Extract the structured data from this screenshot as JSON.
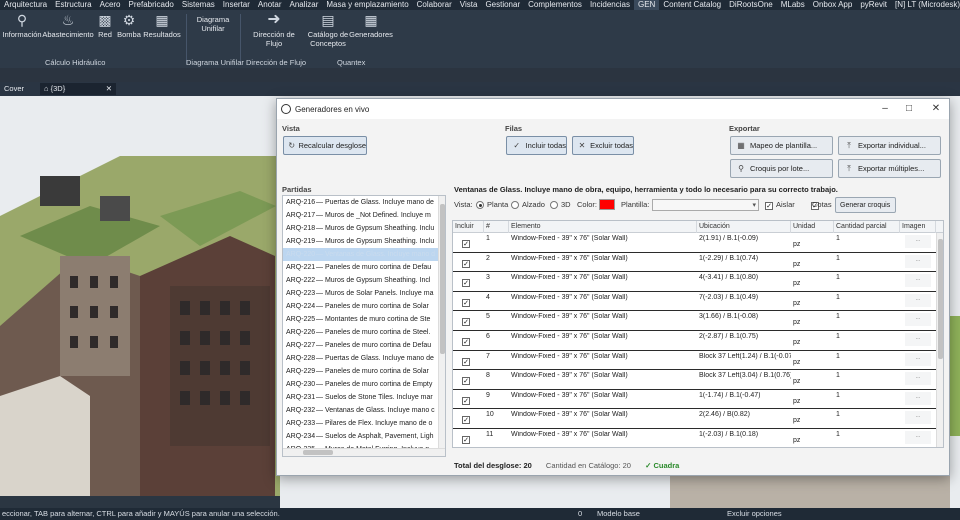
{
  "menu": {
    "tabs": [
      "Arquitectura",
      "Estructura",
      "Acero",
      "Prefabricado",
      "Sistemas",
      "Insertar",
      "Anotar",
      "Analizar",
      "Masa y emplazamiento",
      "Colaborar",
      "Vista",
      "Gestionar",
      "Complementos",
      "Incidencias",
      "GEN",
      "Content Catalog",
      "DiRootsOne",
      "MLabs",
      "Onbox App",
      "pyRevit",
      "[N] LT (Microdesk)"
    ],
    "active": "GEN"
  },
  "ribbon": {
    "buttons": {
      "informacion": "Información",
      "abastecimiento": "Abastecimiento",
      "red": "Red",
      "bomba": "Bomba",
      "resultados": "Resultados",
      "diagrama_unifilar_1": "Diagrama",
      "diagrama_unifilar_2": "Unifilar",
      "direccion_flujo": "Dirección de Flujo",
      "catalogo_1": "Catálogo de",
      "catalogo_2": "Conceptos",
      "generadores": "Generadores"
    },
    "groups": {
      "calculo": "Cálculo Hidráulico",
      "diagrama": "Diagrama Unifilar",
      "flujo": "Dirección de Flujo",
      "quantex": "Quantex"
    }
  },
  "doc_tabs": {
    "cover": "Cover",
    "view3d": "{3D}"
  },
  "dialog": {
    "title": "Generadores en vivo",
    "vista": {
      "label": "Vista",
      "recalcular": "Recalcular desglose"
    },
    "filas": {
      "label": "Filas",
      "incluir": "Incluir todas",
      "excluir": "Excluir todas"
    },
    "exportar": {
      "label": "Exportar",
      "mapeo": "Mapeo de plantilla...",
      "croquis": "Croquis por lote...",
      "individual": "Exportar individual...",
      "multiples": "Exportar múltiples..."
    },
    "partidas": {
      "label": "Partidas",
      "items": [
        {
          "code": "ARQ-216",
          "text": "— Puertas de Glass. Incluye mano de"
        },
        {
          "code": "ARQ-217",
          "text": "— Muros de _Not Defined. Incluye m"
        },
        {
          "code": "ARQ-218",
          "text": "— Muros de Gypsum Sheathing. Inclu"
        },
        {
          "code": "ARQ-219",
          "text": "— Muros de Gypsum Sheathing. Inclu"
        },
        {
          "code": "ARQ-220",
          "text": "— Ventanas de Glass. Incluye mano d"
        },
        {
          "code": "ARQ-221",
          "text": "— Paneles de muro cortina de Defau"
        },
        {
          "code": "ARQ-222",
          "text": "— Muros de Gypsum Sheathing. Incl"
        },
        {
          "code": "ARQ-223",
          "text": "— Muros de Solar Panels. Incluye ma"
        },
        {
          "code": "ARQ-224",
          "text": "— Paneles de muro cortina de Solar"
        },
        {
          "code": "ARQ-225",
          "text": "— Montantes de muro cortina de Ste"
        },
        {
          "code": "ARQ-226",
          "text": "— Paneles de muro cortina de Steel."
        },
        {
          "code": "ARQ-227",
          "text": "— Paneles de muro cortina de Defau"
        },
        {
          "code": "ARQ-228",
          "text": "— Puertas de Glass. Incluye mano de"
        },
        {
          "code": "ARQ-229",
          "text": "— Paneles de muro cortina de Solar"
        },
        {
          "code": "ARQ-230",
          "text": "— Paneles de muro cortina de Empty"
        },
        {
          "code": "ARQ-231",
          "text": "— Suelos de Stone Tiles. Incluye mar"
        },
        {
          "code": "ARQ-232",
          "text": "— Ventanas de Glass. Incluye mano c"
        },
        {
          "code": "ARQ-233",
          "text": "— Pilares de Flex. Incluye mano de o"
        },
        {
          "code": "ARQ-234",
          "text": "— Suelos de Asphalt, Pavement, Ligh"
        },
        {
          "code": "ARQ-235",
          "text": "— Muros de Metal Furring. Incluye n"
        }
      ]
    },
    "description": "Ventanas de Glass. Incluye mano de obra, equipo, herramienta y todo lo necesario para su correcto trabajo.",
    "options": {
      "vista_label": "Vista:",
      "planta": "Planta",
      "alzado": "Alzado",
      "tres_d": "3D",
      "color_label": "Color:",
      "color": "#ff0000",
      "plantilla_label": "Plantilla:",
      "aislar": "Aislar",
      "cotas": "Cotas",
      "generar": "Generar croquis"
    },
    "grid": {
      "headers": [
        "Incluir",
        "#",
        "Elemento",
        "Ubicación",
        "Unidad",
        "Cantidad parcial",
        "Imagen"
      ],
      "rows": [
        {
          "n": "1",
          "elemento": "Window-Fixed - 39\" x 76\" (Solar Wall)",
          "ubicacion": "2(1.91) / B.1(-0.09)",
          "unidad": "pz",
          "cantidad": "1"
        },
        {
          "n": "2",
          "elemento": "Window-Fixed - 39\" x 76\" (Solar Wall)",
          "ubicacion": "1(-2.29) / B.1(0.74)",
          "unidad": "pz",
          "cantidad": "1"
        },
        {
          "n": "3",
          "elemento": "Window-Fixed - 39\" x 76\" (Solar Wall)",
          "ubicacion": "4(-3.41) / B.1(0.80)",
          "unidad": "pz",
          "cantidad": "1"
        },
        {
          "n": "4",
          "elemento": "Window-Fixed - 39\" x 76\" (Solar Wall)",
          "ubicacion": "7(-2.03) / B.1(0.49)",
          "unidad": "pz",
          "cantidad": "1"
        },
        {
          "n": "5",
          "elemento": "Window-Fixed - 39\" x 76\" (Solar Wall)",
          "ubicacion": "3(1.66) / B.1(-0.08)",
          "unidad": "pz",
          "cantidad": "1"
        },
        {
          "n": "6",
          "elemento": "Window-Fixed - 39\" x 76\" (Solar Wall)",
          "ubicacion": "2(-2.87) / B.1(0.75)",
          "unidad": "pz",
          "cantidad": "1"
        },
        {
          "n": "7",
          "elemento": "Window-Fixed - 39\" x 76\" (Solar Wall)",
          "ubicacion": "Block 37 Left(1.24) / B.1(-0.07",
          "unidad": "pz",
          "cantidad": "1"
        },
        {
          "n": "8",
          "elemento": "Window-Fixed - 39\" x 76\" (Solar Wall)",
          "ubicacion": "Block 37 Left(3.04) / B.1(0.76)",
          "unidad": "pz",
          "cantidad": "1"
        },
        {
          "n": "9",
          "elemento": "Window-Fixed - 39\" x 76\" (Solar Wall)",
          "ubicacion": "1(-1.74) / B.1(-0.47)",
          "unidad": "pz",
          "cantidad": "1"
        },
        {
          "n": "10",
          "elemento": "Window-Fixed - 39\" x 76\" (Solar Wall)",
          "ubicacion": "2(2.46) / B(0.82)",
          "unidad": "pz",
          "cantidad": "1"
        },
        {
          "n": "11",
          "elemento": "Window-Fixed - 39\" x 76\" (Solar Wall)",
          "ubicacion": "1(-2.03) / B.1(0.18)",
          "unidad": "pz",
          "cantidad": "1"
        }
      ],
      "image_placeholder": "...",
      "check": "✓"
    },
    "footer": {
      "total": "Total del desglose: 20",
      "catalogo": "Cantidad en Catálogo: 20",
      "cuadra": "✓ Cuadra"
    }
  },
  "status": {
    "text": "eccionar, TAB para alternar, CTRL para añadir y MAYÚS para anular una selección.",
    "model": "Modelo base",
    "excluir": "Excluir opciones",
    "zero": "0"
  }
}
